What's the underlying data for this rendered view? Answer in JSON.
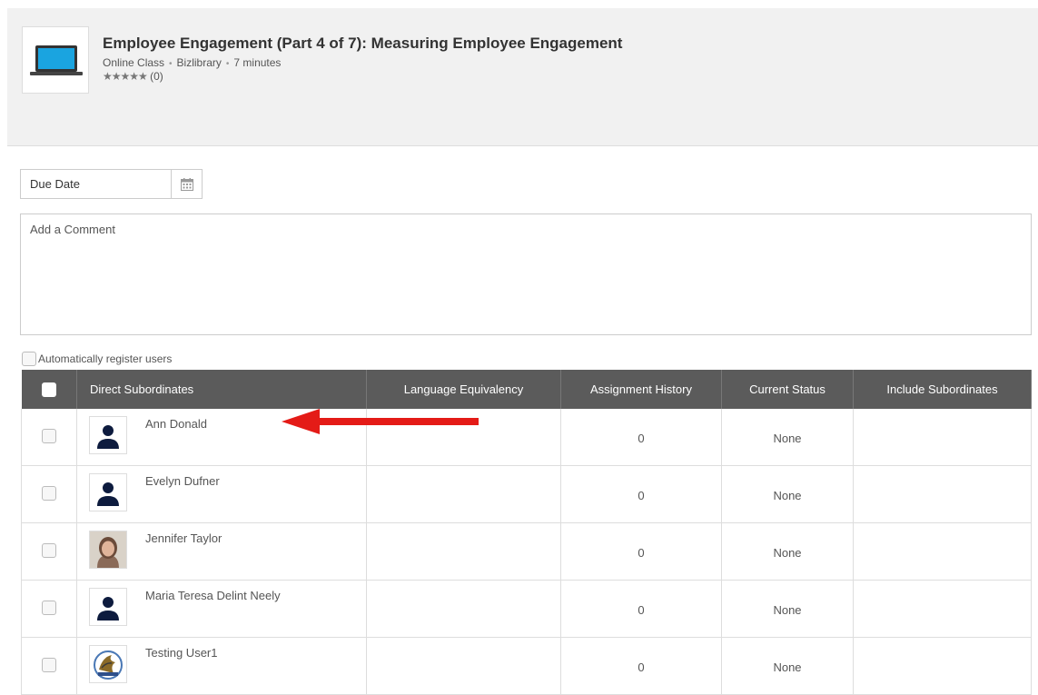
{
  "course": {
    "title": "Employee Engagement (Part 4 of 7): Measuring Employee Engagement",
    "type": "Online Class",
    "provider": "Bizlibrary",
    "duration": "7 minutes",
    "rating_count": "(0)",
    "rating_value": 0,
    "rating_max": 5,
    "thumb_icon": "laptop-icon"
  },
  "form": {
    "due_date_placeholder": "Due Date",
    "comment_placeholder": "Add a Comment",
    "auto_register_label": "Automatically register users"
  },
  "table": {
    "columns": [
      "Direct Subordinates",
      "Language Equivalency",
      "Assignment History",
      "Current Status",
      "Include Subordinates"
    ],
    "rows": [
      {
        "name": "Ann Donald",
        "language": "",
        "history": "0",
        "status": "None",
        "avatar": "default"
      },
      {
        "name": "Evelyn Dufner",
        "language": "",
        "history": "0",
        "status": "None",
        "avatar": "default"
      },
      {
        "name": "Jennifer Taylor",
        "language": "",
        "history": "0",
        "status": "None",
        "avatar": "photo"
      },
      {
        "name": "Maria Teresa Delint Neely",
        "language": "",
        "history": "0",
        "status": "None",
        "avatar": "default"
      },
      {
        "name": "Testing User1",
        "language": "",
        "history": "0",
        "status": "None",
        "avatar": "logo"
      }
    ]
  },
  "colors": {
    "header_bg": "#f1f1f1",
    "table_header_bg": "#5b5b5b",
    "annotation_arrow": "#e41b17",
    "laptop_screen": "#1aa4e0"
  }
}
